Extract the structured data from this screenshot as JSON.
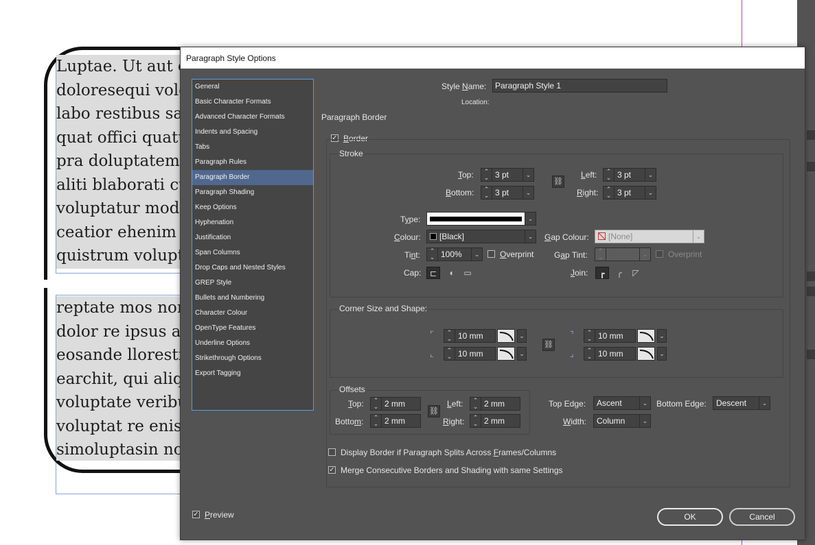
{
  "document": {
    "top_lines": [
      "Luptae. Ut aut o",
      "doloresequi vole",
      "labo restibus sar",
      "quat offici quatu",
      "pra doluptatem",
      "aliti blaborati cu",
      "voluptatur mod",
      "ceatior ehenim",
      "quistrum volupt"
    ],
    "bottom_lines": [
      "reptate mos non",
      "dolor re ipsus as",
      "eosande llorestia",
      "earchit, qui aliq",
      "voluptate veribu",
      "voluptat re enis",
      "simoluptasin no"
    ]
  },
  "dialog": {
    "title": "Paragraph Style Options",
    "categories": [
      {
        "label": "General"
      },
      {
        "label": "Basic Character Formats"
      },
      {
        "label": "Advanced Character Formats"
      },
      {
        "label": "Indents and Spacing"
      },
      {
        "label": "Tabs"
      },
      {
        "label": "Paragraph Rules"
      },
      {
        "label": "Paragraph Border"
      },
      {
        "label": "Paragraph Shading"
      },
      {
        "label": "Keep Options"
      },
      {
        "label": "Hyphenation"
      },
      {
        "label": "Justification"
      },
      {
        "label": "Span Columns"
      },
      {
        "label": "Drop Caps and Nested Styles"
      },
      {
        "label": "GREP Style"
      },
      {
        "label": "Bullets and Numbering"
      },
      {
        "label": "Character Colour"
      },
      {
        "label": "OpenType Features"
      },
      {
        "label": "Underline Options"
      },
      {
        "label": "Strikethrough Options"
      },
      {
        "label": "Export Tagging"
      }
    ],
    "selected_category": "Paragraph Border",
    "style_name_label": "Style Name:",
    "style_name_value": "Paragraph Style 1",
    "location_label": "Location:",
    "section_title": "Paragraph Border",
    "border_label": "Border",
    "border_checked": true,
    "stroke": {
      "title": "Stroke",
      "top_label": "Top:",
      "top_value": "3 pt",
      "bottom_label": "Bottom:",
      "bottom_value": "3 pt",
      "left_label": "Left:",
      "left_value": "3 pt",
      "right_label": "Right:",
      "right_value": "3 pt",
      "type_label": "Type:",
      "colour_label": "Colour:",
      "colour_value": "[Black]",
      "gap_colour_label": "Gap Colour:",
      "gap_colour_value": "[None]",
      "tint_label": "Tint:",
      "tint_value": "100%",
      "overprint_label": "Overprint",
      "gap_tint_label": "Gap Tint:",
      "gap_overprint_label": "Overprint",
      "cap_label": "Cap:",
      "join_label": "Join:"
    },
    "corner": {
      "title": "Corner Size and Shape:",
      "top_left_value": "10 mm",
      "bottom_left_value": "10 mm",
      "top_right_value": "10 mm",
      "bottom_right_value": "10 mm"
    },
    "offsets": {
      "title": "Offsets",
      "top_label": "Top:",
      "top_value": "2 mm",
      "bottom_label": "Bottom:",
      "bottom_value": "2 mm",
      "left_label": "Left:",
      "left_value": "2 mm",
      "right_label": "Right:",
      "right_value": "2 mm",
      "top_edge_label": "Top Edge:",
      "top_edge_value": "Ascent",
      "bottom_edge_label": "Bottom Edge:",
      "bottom_edge_value": "Descent",
      "width_label": "Width:",
      "width_value": "Column"
    },
    "display_split_label": "Display Border if Paragraph Splits Across Frames/Columns",
    "display_split_checked": false,
    "merge_label": "Merge Consecutive Borders and Shading with same Settings",
    "merge_checked": true,
    "preview_label": "Preview",
    "preview_checked": true,
    "ok_label": "OK",
    "cancel_label": "Cancel"
  },
  "colors": {
    "dialog_bg": "#535353",
    "selection": "#50688d",
    "frame_guide": "#82a6d6",
    "margin_guide": "#a54bd6"
  }
}
